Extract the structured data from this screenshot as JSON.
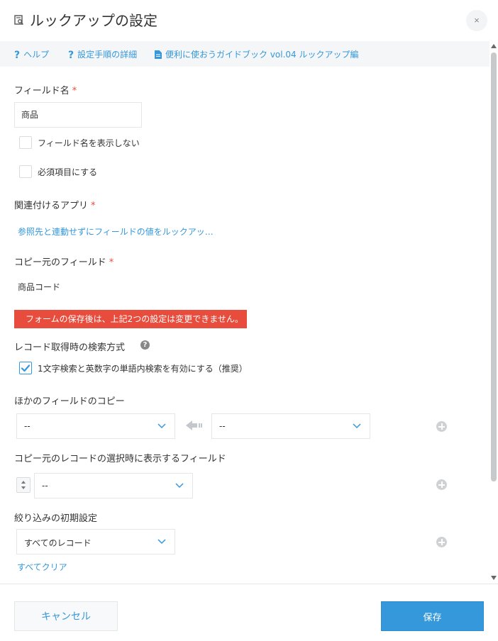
{
  "dialog": {
    "title": "ルックアップの設定",
    "close_label": "×"
  },
  "help_links": [
    {
      "label": "ヘルプ"
    },
    {
      "label": "設定手順の詳細"
    },
    {
      "label": "便利に使おうガイドブック vol.04 ルックアップ編"
    }
  ],
  "field_name": {
    "label": "フィールド名",
    "required_mark": "*",
    "value": "商品",
    "hide_label": "フィールド名を表示しない",
    "hide_checked": false,
    "required_label": "必須項目にする",
    "required_checked": false
  },
  "related_app": {
    "label": "関連付けるアプリ",
    "required_mark": "*",
    "link_text": "参照先と連動せずにフィールドの値をルックアッ…"
  },
  "source_field": {
    "label": "コピー元のフィールド",
    "required_mark": "*",
    "value": "商品コード"
  },
  "alert": {
    "text": "フォームの保存後は、上記2つの設定は変更できません。"
  },
  "search_method": {
    "label": "レコード取得時の検索方式",
    "help_icon": "?",
    "option_label": "1文字検索と英数字の単語内検索を有効にする（推奨）",
    "option_checked": true
  },
  "other_fields_copy": {
    "label": "ほかのフィールドのコピー",
    "left_value": "--",
    "right_value": "--"
  },
  "display_fields": {
    "label": "コピー元のレコードの選択時に表示するフィールド",
    "value": "--"
  },
  "filter": {
    "label": "絞り込みの初期設定",
    "value": "すべてのレコード",
    "clear_label": "すべてクリア"
  },
  "footer": {
    "cancel_label": "キャンセル",
    "save_label": "保存"
  },
  "colors": {
    "accent": "#3498db",
    "alert": "#e74c3c",
    "required": "#e74c3c"
  }
}
